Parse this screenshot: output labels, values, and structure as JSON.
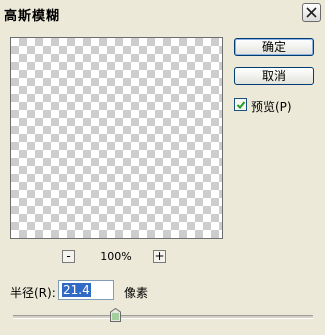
{
  "window": {
    "title": "高斯模糊"
  },
  "buttons": {
    "ok": "确定",
    "cancel": "取消"
  },
  "preview_checkbox": {
    "label": "预览(P)",
    "checked": true
  },
  "zoom": {
    "minus": "-",
    "plus": "+",
    "level": "100%"
  },
  "radius": {
    "label": "半径(R):",
    "value": "21.4",
    "unit": "像素",
    "slider_fraction": 0.34
  },
  "colors": {
    "accent": "#316ac5",
    "dialog_bg": "#ece9d8",
    "checkerboard": "#cdcdcd"
  }
}
